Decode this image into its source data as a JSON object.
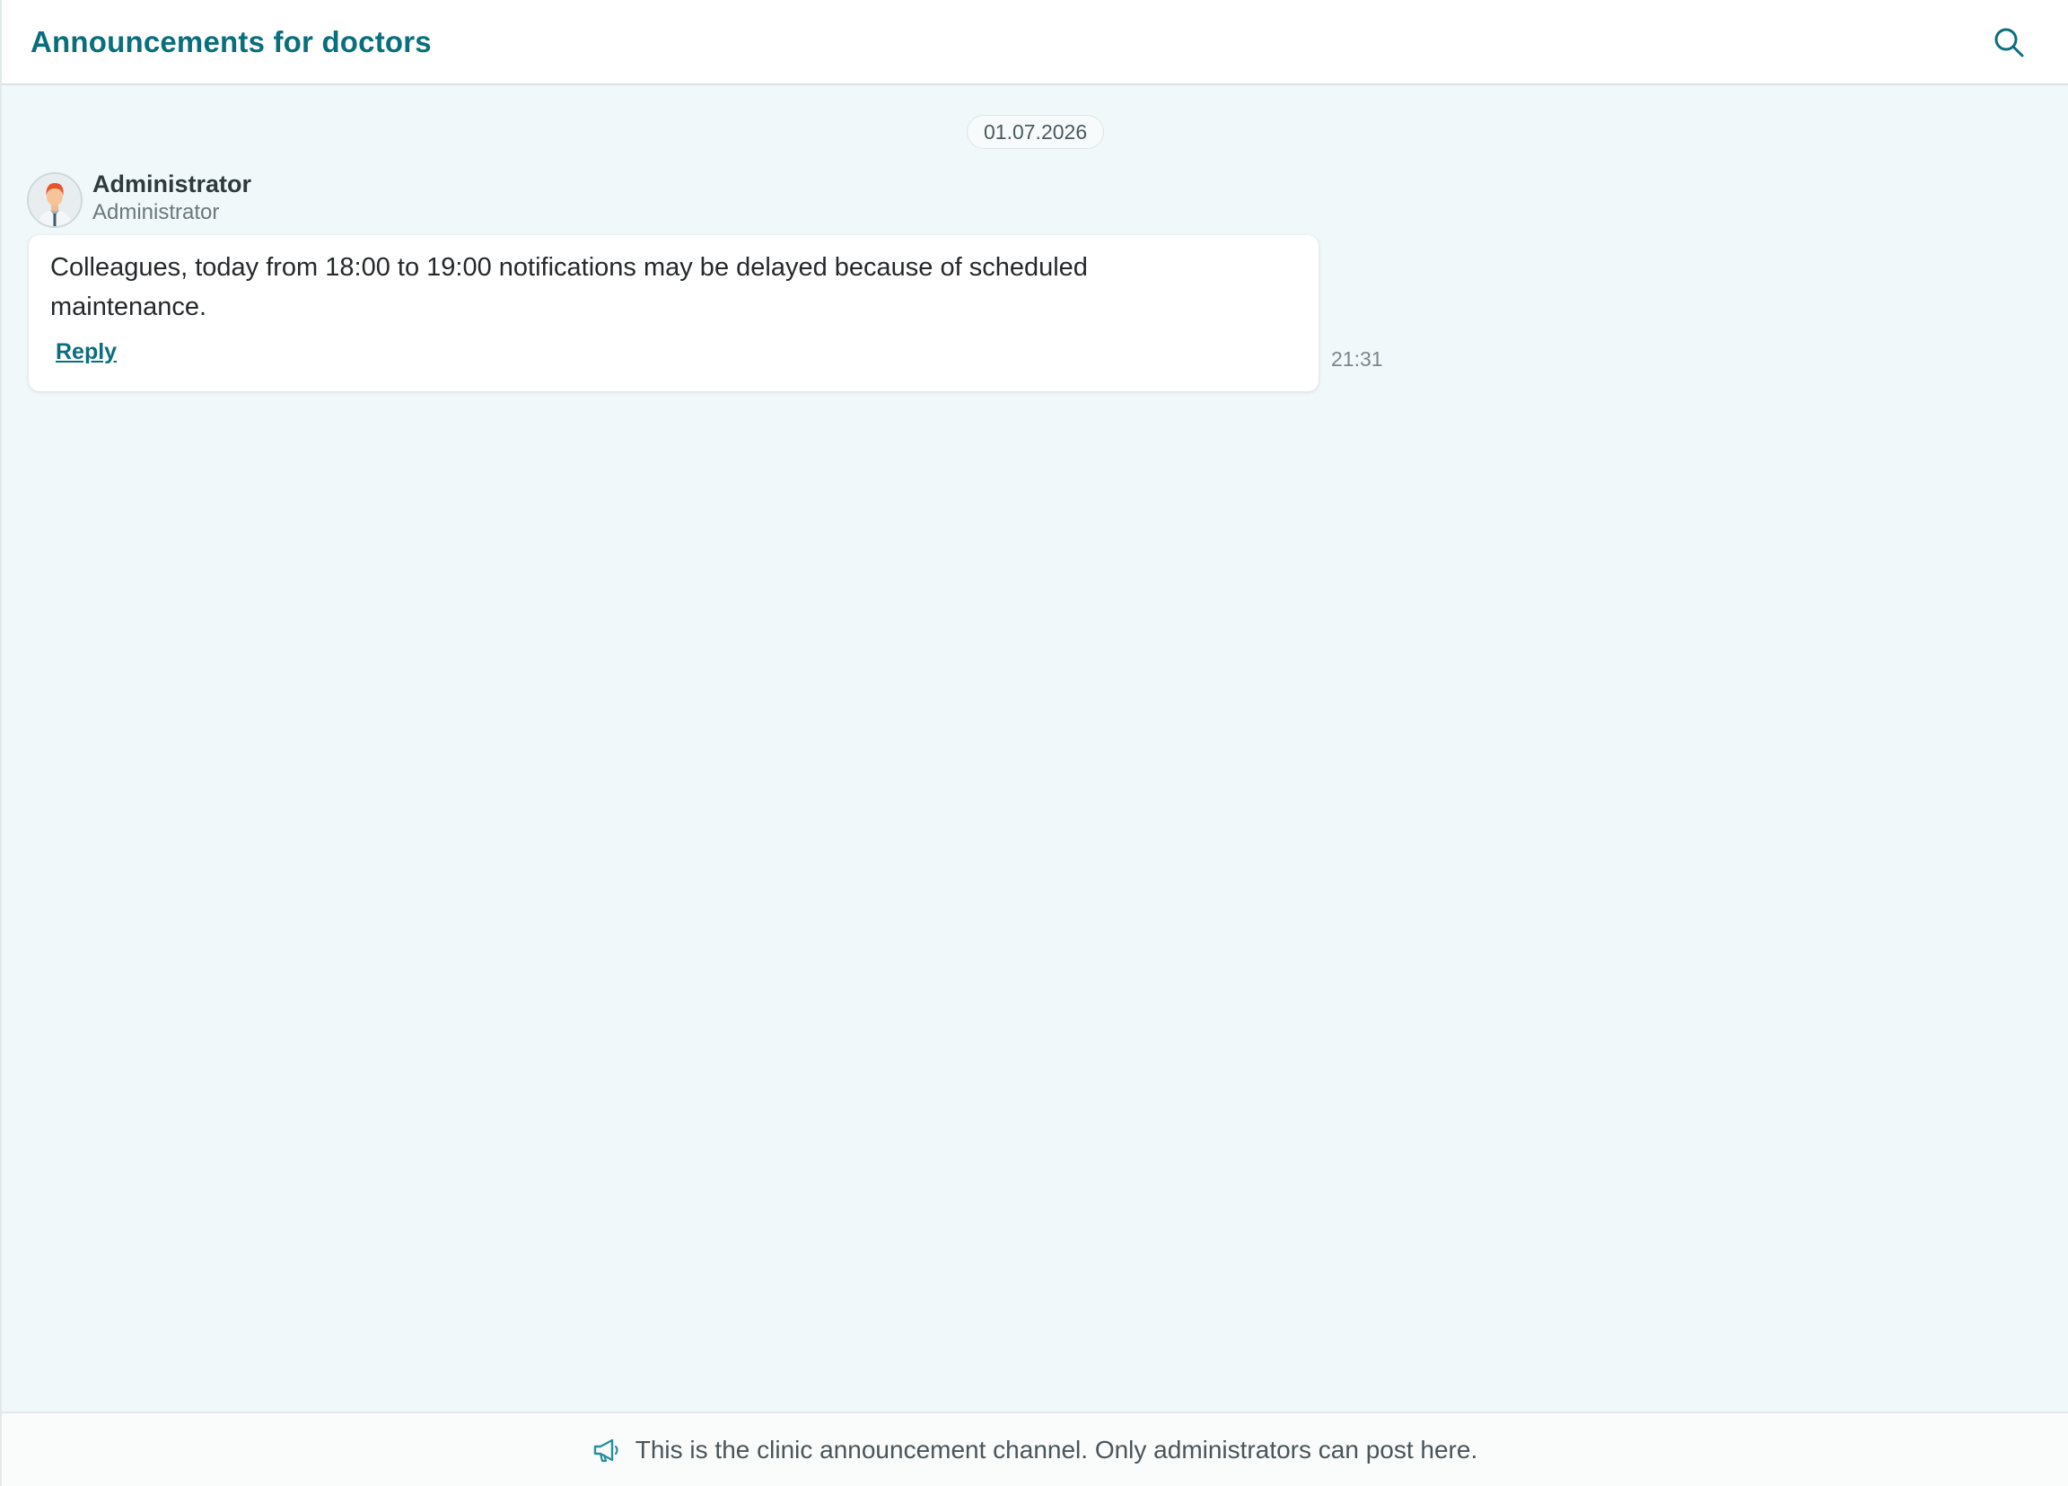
{
  "header": {
    "title": "Announcements for doctors",
    "search_icon": "search-icon"
  },
  "chat": {
    "date_separator": "01.07.2026",
    "messages": [
      {
        "sender_name": "Administrator",
        "sender_role": "Administrator",
        "avatar_icon": "person-avatar",
        "text": "Colleagues, today from 18:00 to 19:00 notifications may be delayed because of scheduled maintenance.",
        "reply_label": "Reply",
        "time": "21:31"
      }
    ]
  },
  "footer": {
    "icon": "megaphone-icon",
    "notice": "This is the clinic announcement channel. Only administrators can post here."
  },
  "colors": {
    "accent": "#0a6e7c",
    "background": "#f1f8f9",
    "header_bg": "#ffffff",
    "bubble_bg": "#ffffff"
  }
}
